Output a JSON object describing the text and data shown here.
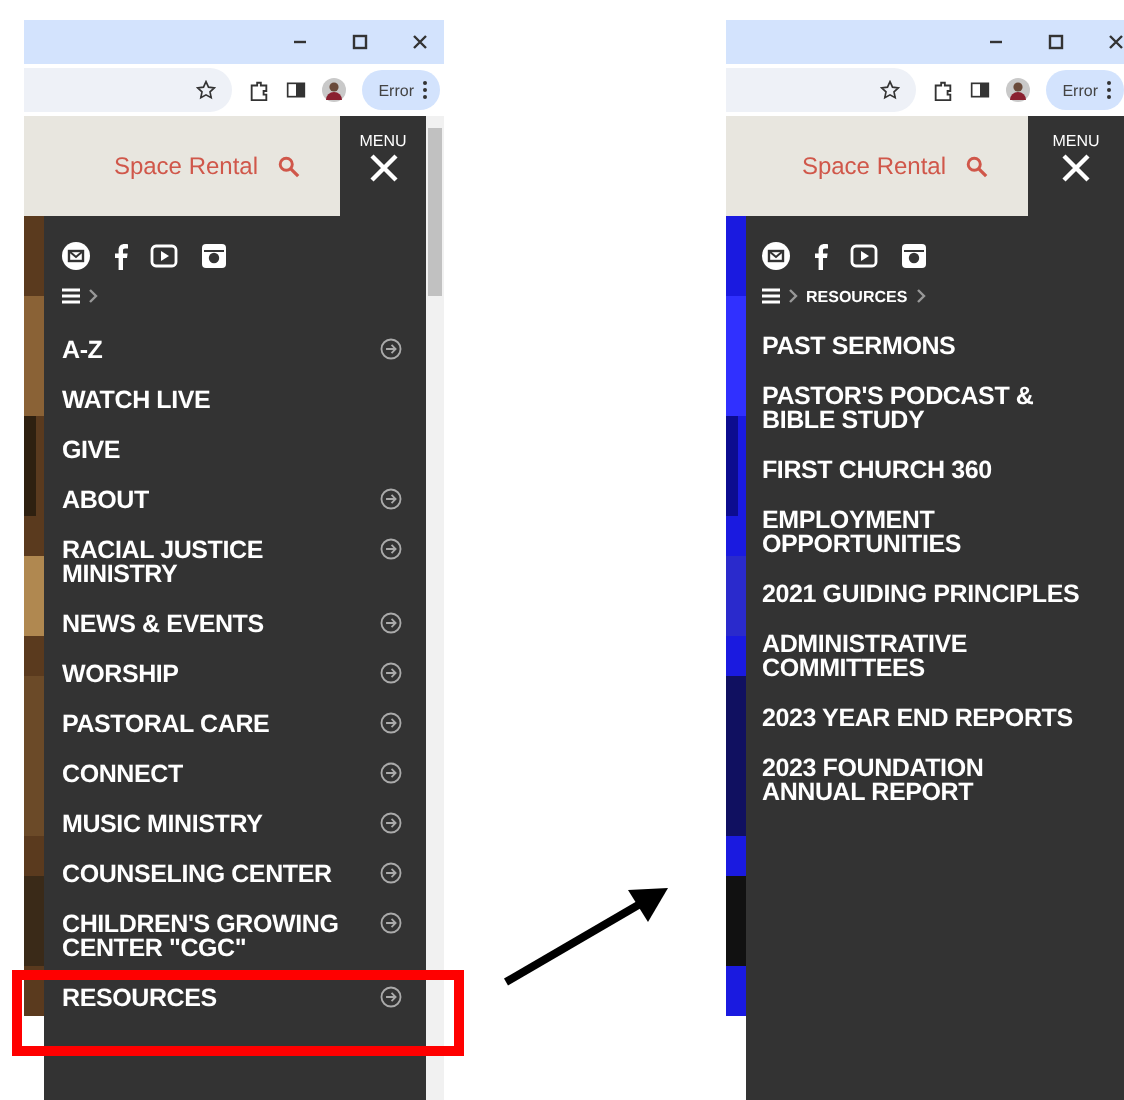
{
  "panels": [
    {
      "kind": "main",
      "profile_button": "Error",
      "header": {
        "link": "Space Rental",
        "menu_label": "MENU"
      },
      "scrollbar": true,
      "items": [
        {
          "label": "A-Z",
          "has_arrow": true,
          "highlighted": false
        },
        {
          "label": "WATCH LIVE",
          "has_arrow": false,
          "highlighted": false
        },
        {
          "label": "GIVE",
          "has_arrow": false,
          "highlighted": false
        },
        {
          "label": "ABOUT",
          "has_arrow": true,
          "highlighted": false
        },
        {
          "label": "RACIAL JUSTICE MINISTRY",
          "has_arrow": true,
          "highlighted": false
        },
        {
          "label": "NEWS & EVENTS",
          "has_arrow": true,
          "highlighted": false
        },
        {
          "label": "WORSHIP",
          "has_arrow": true,
          "highlighted": false
        },
        {
          "label": "PASTORAL CARE",
          "has_arrow": true,
          "highlighted": false
        },
        {
          "label": "CONNECT",
          "has_arrow": true,
          "highlighted": false
        },
        {
          "label": "MUSIC MINISTRY",
          "has_arrow": true,
          "highlighted": false
        },
        {
          "label": "COUNSELING CENTER",
          "has_arrow": true,
          "highlighted": false
        },
        {
          "label": "CHILDREN'S GROWING CENTER \"CGC\"",
          "has_arrow": true,
          "highlighted": false
        },
        {
          "label": "RESOURCES",
          "has_arrow": true,
          "highlighted": true
        }
      ]
    },
    {
      "kind": "submenu",
      "profile_button": "Error",
      "header": {
        "link": "Space Rental",
        "menu_label": "MENU"
      },
      "scrollbar": false,
      "breadcrumb": [
        "RESOURCES"
      ],
      "items": [
        {
          "label": "PAST SERMONS",
          "has_arrow": false,
          "highlighted": false
        },
        {
          "label": "PASTOR'S PODCAST & BIBLE STUDY",
          "has_arrow": false,
          "highlighted": false
        },
        {
          "label": "FIRST CHURCH 360",
          "has_arrow": false,
          "highlighted": false
        },
        {
          "label": "EMPLOYMENT OPPORTUNITIES",
          "has_arrow": false,
          "highlighted": false
        },
        {
          "label": "2021 GUIDING PRINCIPLES",
          "has_arrow": false,
          "highlighted": false
        },
        {
          "label": "ADMINISTRATIVE COMMITTEES",
          "has_arrow": false,
          "highlighted": false
        },
        {
          "label": "2023 YEAR END REPORTS",
          "has_arrow": false,
          "highlighted": false
        },
        {
          "label": "2023 FOUNDATION ANNUAL REPORT",
          "has_arrow": false,
          "highlighted": false
        }
      ]
    }
  ]
}
